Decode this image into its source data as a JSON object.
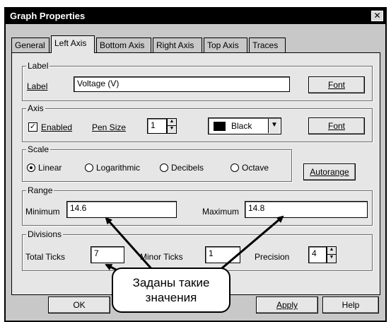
{
  "window": {
    "title": "Graph Properties",
    "close_label": "✕"
  },
  "tabs": [
    "General",
    "Left Axis",
    "Bottom Axis",
    "Right Axis",
    "Top Axis",
    "Traces"
  ],
  "active_tab": "Left Axis",
  "label_group": {
    "legend": "Label",
    "field_label": "Label",
    "field_value": "Voltage (V)",
    "font_button": "Font"
  },
  "axis_group": {
    "legend": "Axis",
    "enabled_label": "Enabled",
    "enabled_checked": true,
    "pen_size_label": "Pen Size",
    "pen_size_value": "1",
    "color_value": "Black",
    "color_hex": "#000000",
    "font_button": "Font"
  },
  "scale_group": {
    "legend": "Scale",
    "options": [
      "Linear",
      "Logarithmic",
      "Decibels",
      "Octave"
    ],
    "selected": "Linear",
    "autorange_button": "Autorange"
  },
  "range_group": {
    "legend": "Range",
    "minimum_label": "Minimum",
    "minimum_value": "14.6",
    "maximum_label": "Maximum",
    "maximum_value": "14.8"
  },
  "divisions_group": {
    "legend": "Divisions",
    "total_ticks_label": "Total Ticks",
    "total_ticks_value": "7",
    "minor_ticks_label": "Minor Ticks",
    "minor_ticks_value": "1",
    "precision_label": "Precision",
    "precision_value": "4"
  },
  "footer_buttons": {
    "ok": "OK",
    "apply": "Apply",
    "help": "Help"
  },
  "annotation": {
    "line1": "Заданы такие",
    "line2": "значения"
  }
}
